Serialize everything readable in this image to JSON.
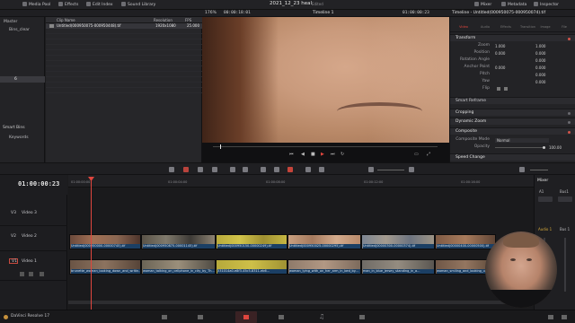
{
  "topbar": {
    "items": [
      "Media Pool",
      "Effects",
      "Edit Index",
      "Sound Library"
    ],
    "project_title": "2021_12_23 heal",
    "status": "Edited",
    "right_items": [
      "Mixer",
      "Metadata",
      "Inspector"
    ]
  },
  "subbar": {
    "zoom": "176%",
    "source_tc": "00:00:18:01",
    "timeline_name": "Timeline 1",
    "record_tc": "01:00:00:23",
    "inspector_title": "Timeline - Untitled(000950075-000950074).tif"
  },
  "leftpanel": {
    "items": [
      "Master",
      "Bins_clear",
      "",
      "",
      "",
      "",
      "6"
    ],
    "smart_bins": "Smart Bins",
    "keywords": "Keywords"
  },
  "mediapool": {
    "headers": [
      "Clip Name",
      "Resolution",
      "FPS"
    ],
    "row": {
      "name": "Untitled(000950075-000950448).tif",
      "res": "1920x1080",
      "fps": "25.000"
    }
  },
  "viewer": {
    "description_tc_left": "00:00:18:01"
  },
  "inspector": {
    "tabs": [
      "Video",
      "Audio",
      "Effects",
      "Transition",
      "Image",
      "File"
    ],
    "sections": {
      "transform": "Transform",
      "smart_reframe": "Smart Reframe",
      "cropping": "Cropping",
      "dynamic_zoom": "Dynamic Zoom",
      "composite": "Composite",
      "speed_change": "Speed Change"
    },
    "rows": [
      {
        "label": "Zoom",
        "x": "1.000",
        "y": "1.000"
      },
      {
        "label": "Position",
        "x": "0.000",
        "y": "0.000"
      },
      {
        "label": "Rotation Angle",
        "x": "0.000",
        "y": ""
      },
      {
        "label": "Anchor Point",
        "x": "0.000",
        "y": "0.000"
      },
      {
        "label": "Pitch",
        "x": "0.000",
        "y": ""
      },
      {
        "label": "Yaw",
        "x": "0.000",
        "y": ""
      },
      {
        "label": "Flip",
        "x": "",
        "y": ""
      }
    ],
    "composite_mode_label": "Composite Mode",
    "composite_mode": "Normal",
    "opacity_label": "Opacity",
    "opacity": "100.00"
  },
  "timeline": {
    "timecode": "01:00:00:23",
    "ruler_labels": [
      "01:00:00:00",
      "01:00:04:00",
      "01:00:08:00",
      "01:00:12:00",
      "01:00:16:00"
    ],
    "tracks": [
      {
        "id": "V3",
        "name": "Video 3"
      },
      {
        "id": "V2",
        "name": "Video 2"
      },
      {
        "id": "V1",
        "name": "Video 1"
      }
    ],
    "v2_clips": [
      "Untitled(000950000-00000745).tif",
      "Untitled(000950875-00001145).tif",
      "Untitled(000950150-00000249).tif",
      "Untitled(000950025-00000295).tif",
      "Untitled(00000300-00000374).tif",
      "Untitled(00000400-00000500).tif"
    ],
    "v1_clips": [
      "brunette_woman_looking_down_and_writin...",
      "woman_talking_on_cellphone_in_city_by_Th...",
      "331014a0-e8f3-45c5-8311-eb6...",
      "woman_lying_with_on_her_arm_in_bed_by...",
      "man_in_blue_jersey_standing_in_a...",
      "woman_smiling_and_looking_up..."
    ]
  },
  "mixer": {
    "title": "Mixer",
    "ch1": "A1",
    "ch2": "Bus1",
    "audio1": "Audio 1",
    "bus1": "Bus 1"
  },
  "bottombar": {
    "app_name": "DaVinci Resolve 17"
  },
  "colors": {
    "accent_red": "#e0463e",
    "clip_blue": "#1b3f64",
    "panel_bg": "#232326"
  }
}
